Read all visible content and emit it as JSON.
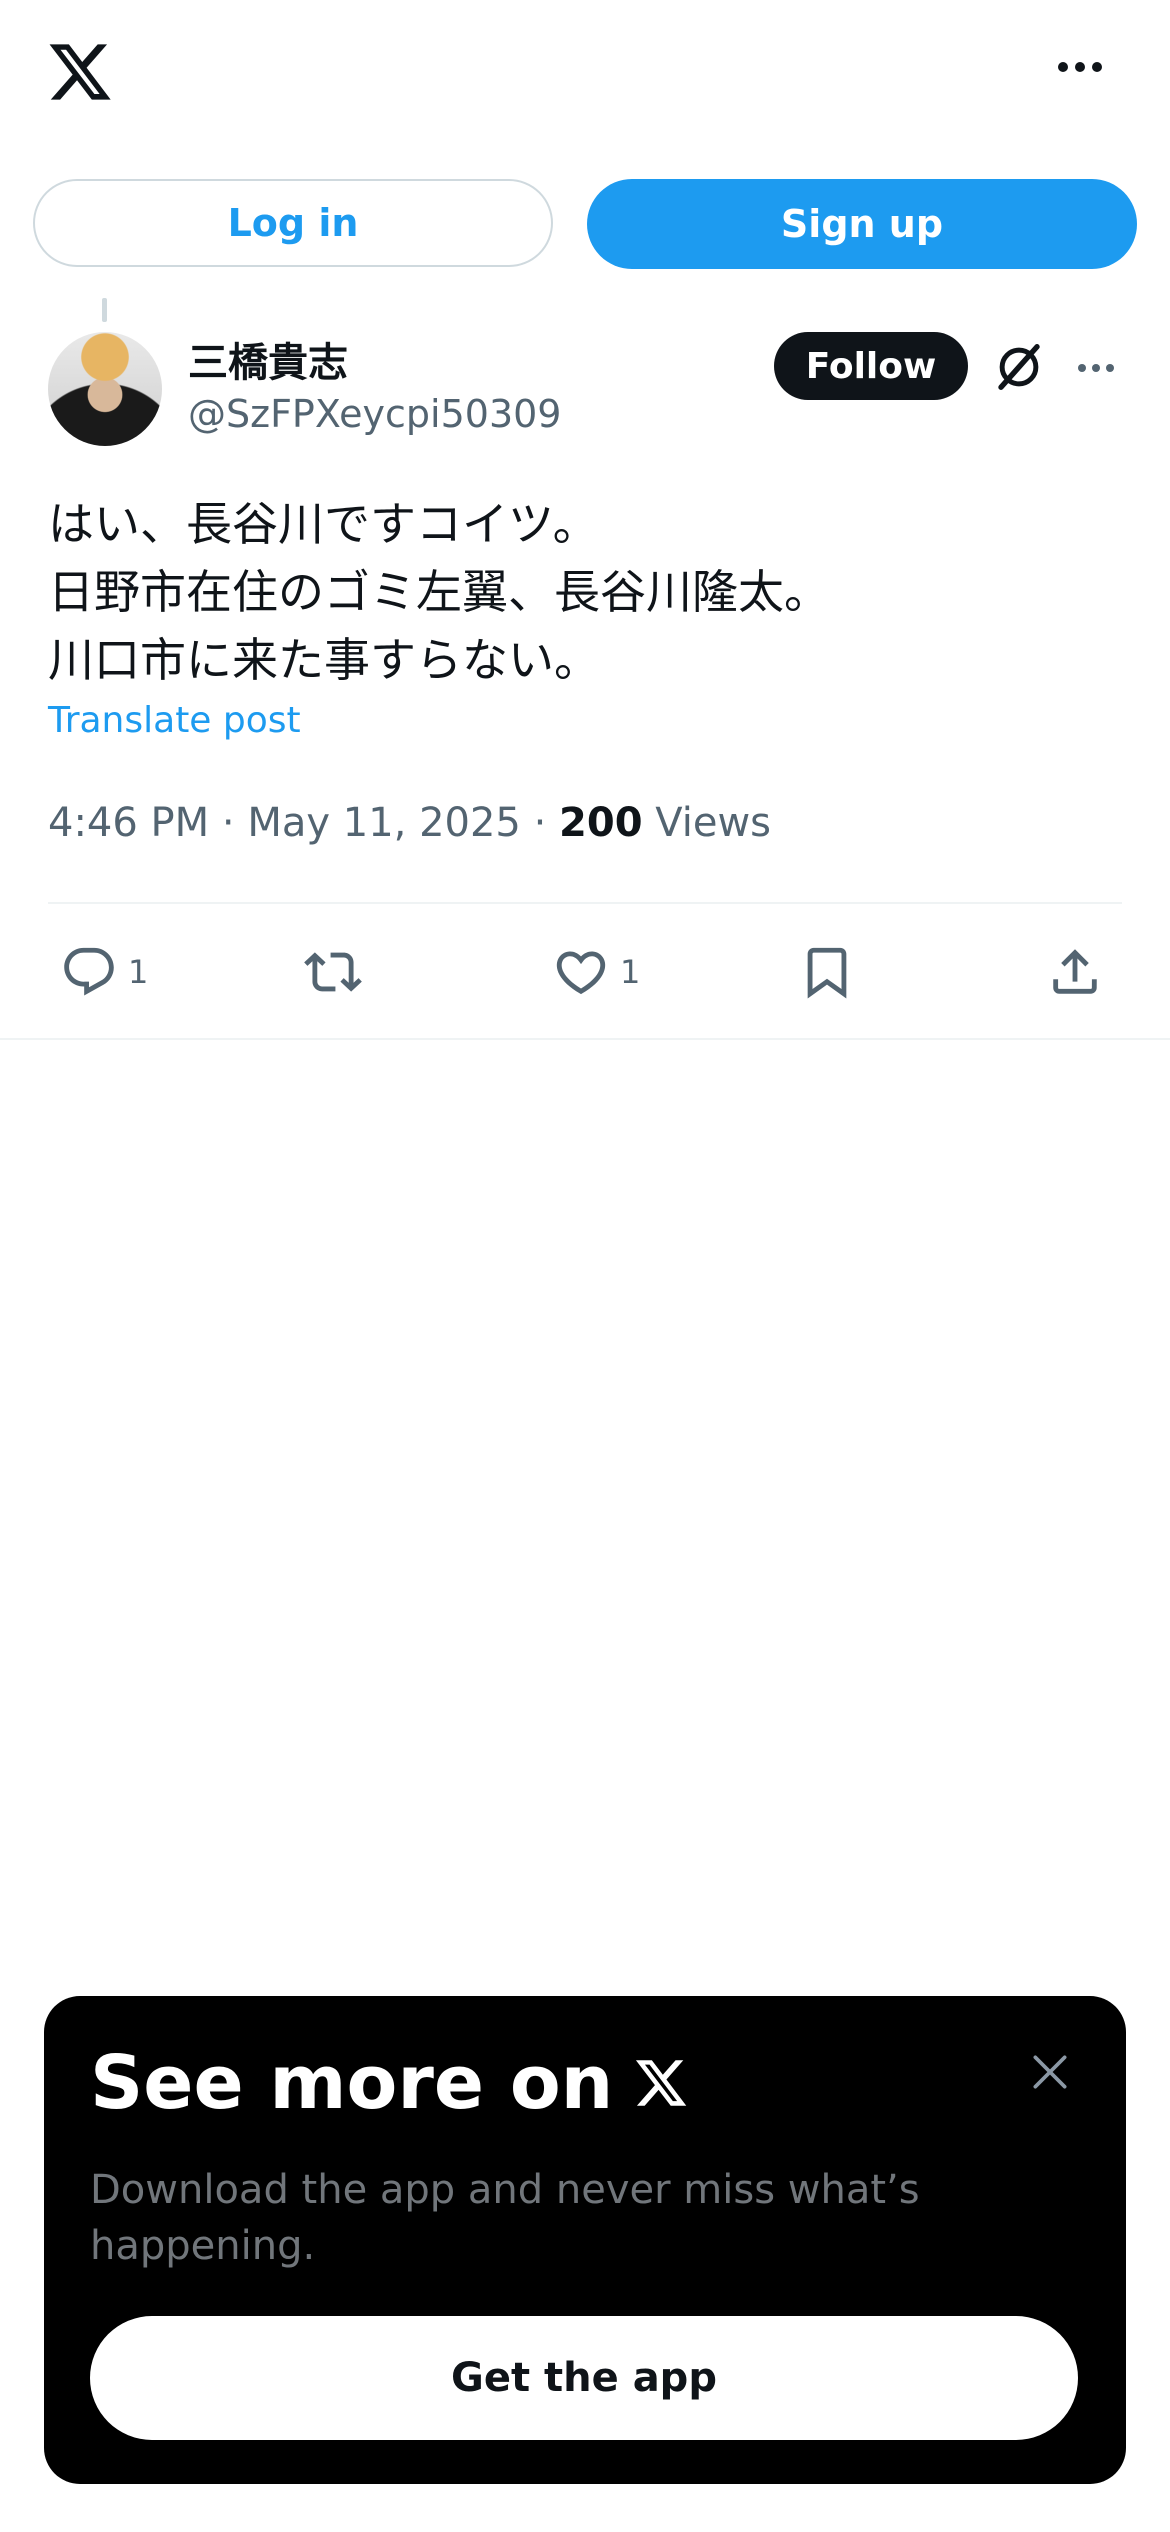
{
  "header": {
    "logo_icon": "x-logo-icon",
    "more_icon": "more-horizontal-icon"
  },
  "auth": {
    "login_label": "Log in",
    "signup_label": "Sign up"
  },
  "post": {
    "author_name": "三橋貴志",
    "author_handle": "@SzFPXeycpi50309",
    "follow_label": "Follow",
    "text_lines": [
      "はい、長谷川ですコイツ。",
      "日野市在住のゴミ左翼、長谷川隆太。",
      "川口市に来た事すらない。"
    ],
    "translate_label": "Translate post",
    "time": "4:46 PM",
    "date": "May 11, 2025",
    "views_count": "200",
    "views_label": "Views",
    "separator": "·",
    "actions": {
      "reply_count": "1",
      "like_count": "1"
    }
  },
  "banner": {
    "title": "See more on",
    "subtitle": "Download the app and never miss what’s happening.",
    "cta_label": "Get the app"
  },
  "colors": {
    "accent": "#1d9bf0",
    "text_primary": "#0f1419",
    "text_secondary": "#536471"
  }
}
